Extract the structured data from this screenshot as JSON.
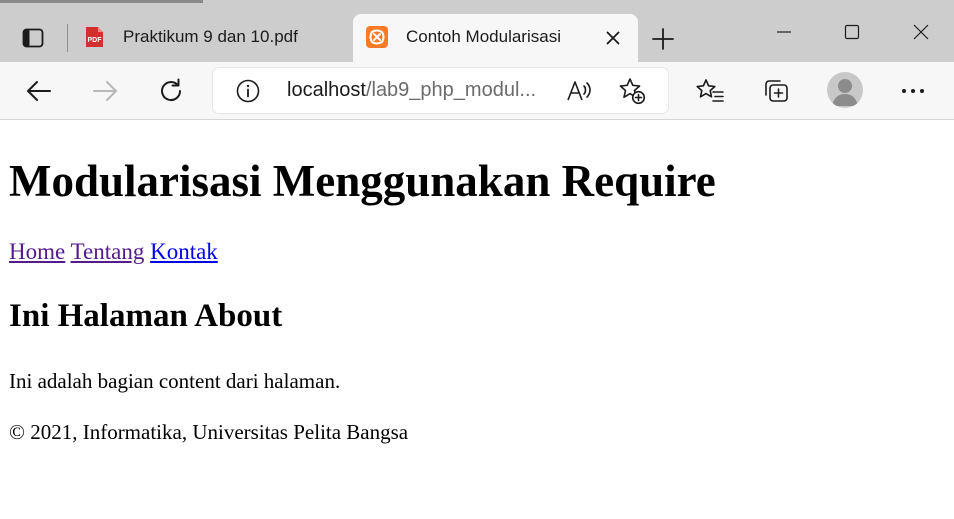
{
  "tabs": [
    {
      "title": "Praktikum 9 dan 10.pdf",
      "favicon": "pdf-icon",
      "favicon_text": "PDF",
      "active": false
    },
    {
      "title": "Contoh Modularisasi",
      "favicon": "xampp-icon",
      "active": true
    }
  ],
  "address_bar": {
    "host": "localhost",
    "path": "/lab9_php_modul..."
  },
  "page": {
    "heading": "Modularisasi Menggunakan Require",
    "nav": [
      {
        "label": "Home",
        "visited": true
      },
      {
        "label": "Tentang",
        "visited": true
      },
      {
        "label": "Kontak",
        "visited": false
      }
    ],
    "subheading": "Ini Halaman About",
    "paragraph": "Ini adalah bagian content dari halaman.",
    "footer": "© 2021, Informatika, Universitas Pelita Bangsa"
  },
  "colors": {
    "link_visited": "#551a8b",
    "link_unvisited": "#0000ee",
    "pdf_red": "#d32f2f",
    "xampp_orange": "#fb7a24"
  }
}
